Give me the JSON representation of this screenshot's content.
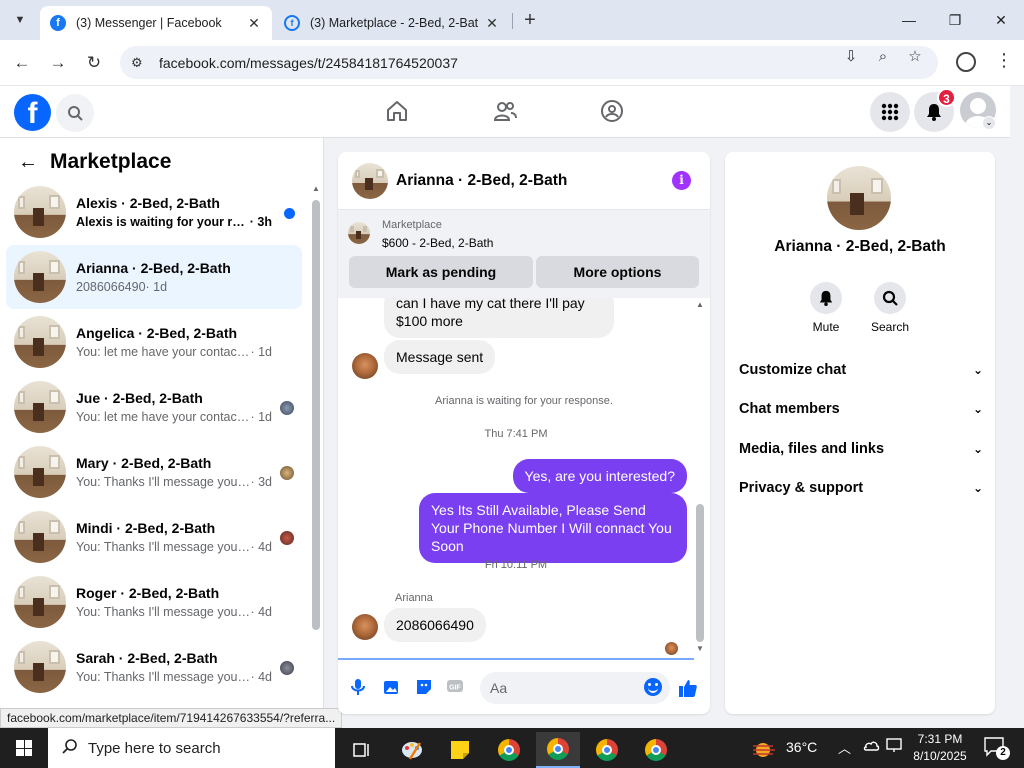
{
  "browser": {
    "tabs": [
      {
        "title": "(3) Messenger | Facebook",
        "active": true
      },
      {
        "title": "(3) Marketplace - 2-Bed, 2-Bath",
        "active": false
      }
    ],
    "url": "facebook.com/messages/t/24584181764520037",
    "status_url": "facebook.com/marketplace/item/719414267633554/?referra..."
  },
  "header": {
    "notification_count": "3",
    "nav_icons": [
      "home-icon",
      "friends-icon",
      "groups-icon"
    ]
  },
  "sidebar": {
    "title": "Marketplace",
    "conversations": [
      {
        "name": "Alexis · 2-Bed, 2-Bath",
        "snippet": "Alexis is waiting for your respo...",
        "time": " · 3h",
        "unread": true,
        "active": false
      },
      {
        "name": "Arianna · 2-Bed, 2-Bath",
        "snippet": "2086066490",
        "time": " · 1d",
        "unread": false,
        "active": true
      },
      {
        "name": "Angelica · 2-Bed, 2-Bath",
        "snippet": "You: let me have your contact num...",
        "time": " · 1d",
        "unread": false,
        "active": false
      },
      {
        "name": "Jue · 2-Bed, 2-Bath",
        "snippet": "You: let me have your contact n...",
        "time": " · 1d",
        "unread": false,
        "active": false
      },
      {
        "name": "Mary · 2-Bed, 2-Bath",
        "snippet": "You: Thanks I'll message you in ...",
        "time": " · 3d",
        "unread": false,
        "active": false
      },
      {
        "name": "Mindi · 2-Bed, 2-Bath",
        "snippet": "You: Thanks I'll message you in ...",
        "time": " · 4d",
        "unread": false,
        "active": false
      },
      {
        "name": "Roger · 2-Bed, 2-Bath",
        "snippet": "You: Thanks I'll message you in a ...",
        "time": " · 4d",
        "unread": false,
        "active": false
      },
      {
        "name": "Sarah · 2-Bed, 2-Bath",
        "snippet": "You: Thanks I'll message you in ...",
        "time": " · 4d",
        "unread": false,
        "active": false
      }
    ]
  },
  "chat": {
    "title": "Arianna · 2-Bed, 2-Bath",
    "marketplace_label": "Marketplace",
    "item": "$600 - 2-Bed, 2-Bath",
    "mark_pending": "Mark as pending",
    "more_options": "More options",
    "messages": {
      "m1": "can I have my cat there I'll pay $100 more",
      "m2": "Message sent",
      "system": "Arianna is waiting for your response.",
      "ts1": "Thu 7:41 PM",
      "out1": "Yes, are you interested?",
      "out2": "Yes Its Still Available, Please Send Your Phone Number I Will connact You Soon",
      "ts2": "Fri 10:11 PM",
      "sender": "Arianna",
      "m3": "2086066490"
    },
    "composer_placeholder": "Aa"
  },
  "details": {
    "name": "Arianna · 2-Bed, 2-Bath",
    "mute": "Mute",
    "search": "Search",
    "sections": [
      "Customize chat",
      "Chat members",
      "Media, files and links",
      "Privacy & support"
    ]
  },
  "taskbar": {
    "search_placeholder": "Type here to search",
    "temperature": "36°C",
    "time": "7:31 PM",
    "date": "8/10/2025",
    "notification_count": "2"
  }
}
